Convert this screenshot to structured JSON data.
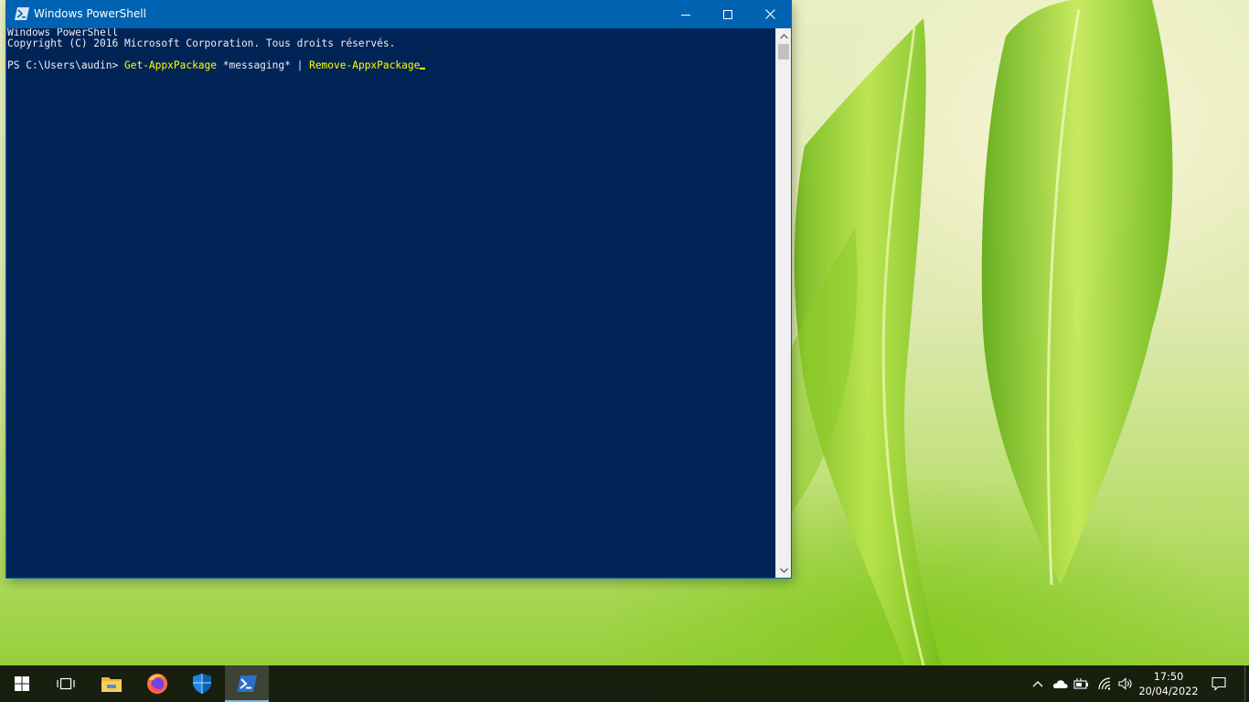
{
  "window": {
    "title": "Windows PowerShell",
    "icon": "powershell-icon",
    "controls": {
      "minimize_icon": "minimize-icon",
      "maximize_icon": "maximize-icon",
      "close_icon": "close-icon"
    }
  },
  "console": {
    "lines": [
      "Windows PowerShell",
      "Copyright (C) 2016 Microsoft Corporation. Tous droits réservés."
    ],
    "prompt": "PS C:\\Users\\audin> ",
    "command": {
      "cmd1": "Get-AppxPackage",
      "arg1": " *messaging* | ",
      "cmd2": "Remove-AppxPackage"
    },
    "colors": {
      "background": "#012456",
      "foreground": "#eeedf0",
      "command": "#ffff00"
    }
  },
  "taskbar": {
    "pinned": [
      {
        "name": "start",
        "icon": "windows-logo-icon"
      },
      {
        "name": "task-view",
        "icon": "task-view-icon"
      },
      {
        "name": "file-explorer",
        "icon": "folder-icon"
      },
      {
        "name": "firefox",
        "icon": "firefox-icon"
      },
      {
        "name": "windows-security",
        "icon": "shield-icon"
      },
      {
        "name": "powershell",
        "icon": "powershell-icon",
        "active": true
      }
    ],
    "tray": {
      "icons": [
        "chevron-up-icon",
        "onedrive-cloud-icon",
        "power-plug-icon",
        "wifi-icon",
        "volume-icon"
      ],
      "time": "17:50",
      "date": "20/04/2022",
      "notifications_icon": "notifications-icon"
    }
  }
}
